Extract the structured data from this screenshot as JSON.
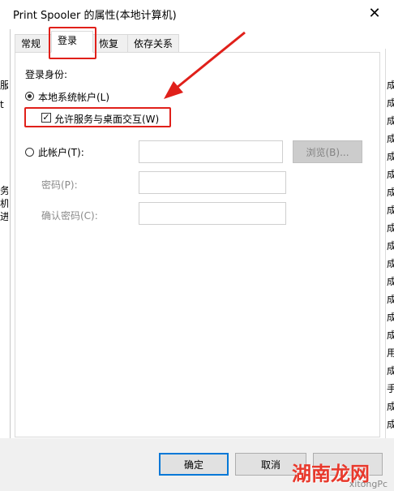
{
  "window": {
    "title": "Print Spooler 的属性(本地计算机)",
    "close_glyph": "✕"
  },
  "tabs": [
    {
      "label": "常规"
    },
    {
      "label": "登录"
    },
    {
      "label": "恢复"
    },
    {
      "label": "依存关系"
    }
  ],
  "login": {
    "section_label": "登录身份:",
    "local_system_label": "本地系统帐户(L)",
    "allow_desktop_label": "允许服务与桌面交互(W)",
    "this_account_label": "此帐户(T):",
    "browse_label": "浏览(B)...",
    "password_label": "密码(P):",
    "confirm_password_label": "确认密码(C):",
    "account_value": "",
    "password_value": "",
    "confirm_value": "",
    "local_system_selected": true,
    "allow_desktop_checked": true
  },
  "footer": {
    "ok_label": "确定",
    "cancel_label": "取消"
  },
  "background": {
    "left_chars": [
      "服",
      "t",
      "务",
      "机",
      "进"
    ],
    "right_char": "成",
    "right_char_b": "用",
    "right_char_c": "手"
  },
  "watermark": {
    "main": "湖南龙网",
    "small": "xitongPc"
  },
  "colors": {
    "annotation_red": "#e0201a",
    "default_button_border": "#0078d7"
  }
}
